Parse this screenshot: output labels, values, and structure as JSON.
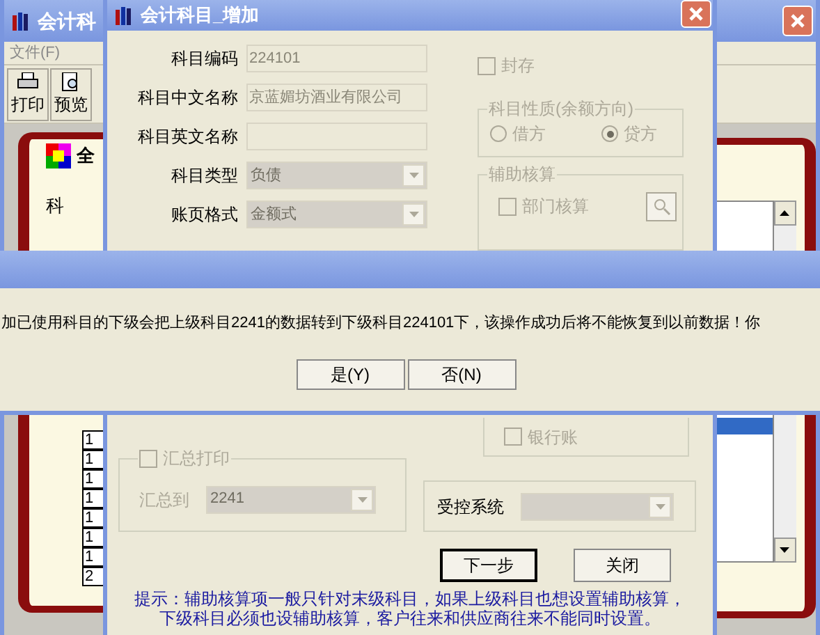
{
  "main_window": {
    "title": "会计科",
    "menu": [
      "文件(F)"
    ],
    "toolbar": [
      "打印",
      "预览"
    ],
    "tab": "全",
    "label": "科",
    "level_cells": [
      "1",
      "1",
      "1",
      "1",
      "1",
      "1",
      "1",
      "2"
    ]
  },
  "dialog": {
    "title": "会计科目_增加",
    "fields": [
      {
        "label": "科目编码",
        "value": "224101",
        "kind": "text",
        "disabled": true
      },
      {
        "label": "科目中文名称",
        "value": "京蓝媚坊酒业有限公司",
        "kind": "text",
        "disabled": true
      },
      {
        "label": "科目英文名称",
        "kind": "text",
        "disabled": true
      },
      {
        "label": "科目类型",
        "value": "负债",
        "kind": "select",
        "disabled": true
      },
      {
        "label": "账页格式",
        "value": "金额式",
        "kind": "select",
        "disabled": true
      }
    ],
    "archived": {
      "label": "封存",
      "checked": false
    },
    "direction": {
      "title": "科目性质(余额方向)",
      "options": [
        {
          "label": "借方",
          "selected": false
        },
        {
          "label": "贷方",
          "selected": true
        }
      ]
    },
    "aux": {
      "title": "辅助核算",
      "items": [
        {
          "label": "部门核算",
          "checked": false
        }
      ]
    },
    "bank": {
      "label": "银行账",
      "checked": false
    },
    "summary": {
      "label": "汇总打印",
      "checked": false,
      "to_label": "汇总到",
      "to_value": "2241"
    },
    "controlled": {
      "label": "受控系统"
    },
    "buttons": [
      "下一步",
      "关闭"
    ],
    "hint": [
      "提示：辅助核算项一般只针对末级科目，如果上级科目也想设置辅助核算，",
      "下级科目必须也设辅助核算，客户往来和供应商往来不能同时设置。"
    ]
  },
  "message_box": {
    "text": "加已使用科目的下级会把上级科目2241的数据转到下级科目224101下，该操作成功后将不能恢复到以前数据！你",
    "buttons": [
      "是(Y)",
      "否(N)"
    ]
  }
}
